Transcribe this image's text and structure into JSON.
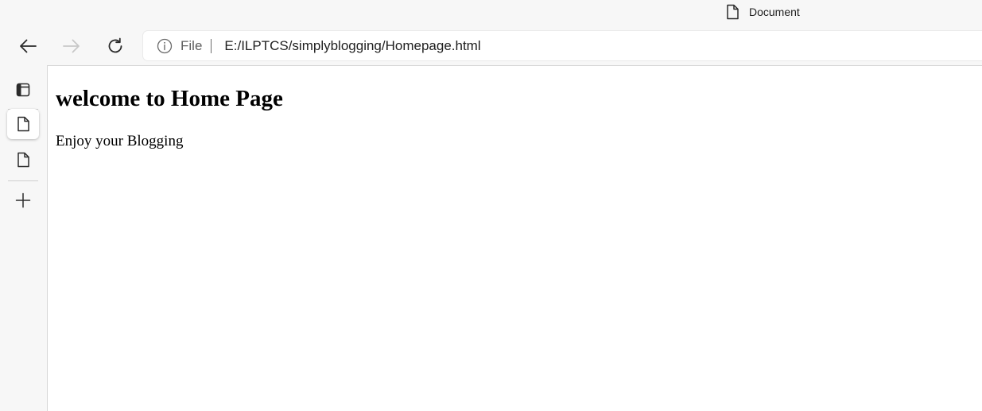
{
  "window": {
    "tab_title": "Document",
    "tab_icon": "document-icon"
  },
  "toolbar": {
    "back_icon": "back-arrow-icon",
    "forward_icon": "forward-arrow-icon",
    "forward_enabled": false,
    "refresh_icon": "refresh-icon",
    "address": {
      "info_icon": "info-icon",
      "scheme_label": "File",
      "url": "E:/ILPTCS/simplyblogging/Homepage.html"
    }
  },
  "sidebar": {
    "items": [
      {
        "icon": "tab-actions-icon",
        "active": false
      },
      {
        "icon": "document-icon",
        "active": true
      },
      {
        "icon": "document-icon",
        "active": false
      },
      {
        "icon": "plus-icon",
        "active": false
      }
    ]
  },
  "page": {
    "heading": "welcome to Home Page",
    "paragraph": "Enjoy your Blogging"
  },
  "colors": {
    "chrome_background": "#f7f7f7",
    "page_background": "#ffffff",
    "disabled_icon": "#c8c8c8",
    "icon": "#2b2b2b"
  }
}
